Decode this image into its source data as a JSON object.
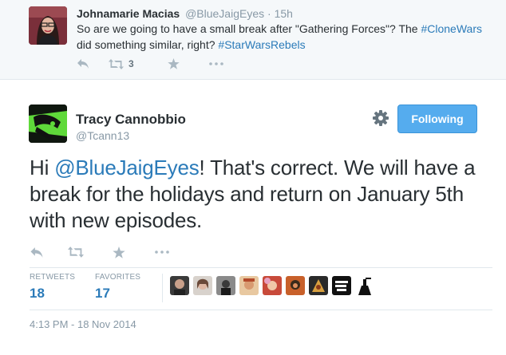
{
  "parent_tweet": {
    "author_name": "Johnamarie Macias",
    "author_handle": "@BlueJaigEyes",
    "separator": "·",
    "time": "15h",
    "text_before": "So are we going to have a small break after \"Gathering Forces\"? The ",
    "hashtag1": "#CloneWars",
    "text_middle": " did something similar, right? ",
    "hashtag2": "#StarWarsRebels",
    "retweet_count": "3"
  },
  "main_tweet": {
    "author_name": "Tracy Cannobbio",
    "author_handle": "@Tcann13",
    "follow_label": "Following",
    "text_prefix": "Hi ",
    "mention": "@BlueJaigEyes",
    "text_rest": "! That's correct. We will have a break for the holidays and return on January 5th with new episodes.",
    "stats": {
      "retweets_label": "RETWEETS",
      "retweets_value": "18",
      "favorites_label": "FAVORITES",
      "favorites_value": "17"
    },
    "timestamp": "4:13 PM - 18 Nov 2014"
  },
  "icons": {
    "reply": "reply-icon",
    "retweet": "retweet-icon",
    "favorite": "star-icon",
    "more": "more-icon",
    "settings": "gear-icon"
  },
  "colors": {
    "link": "#2b7bb9",
    "follow_button": "#55acee",
    "muted": "#8899a6",
    "action_icon": "#aab8c2",
    "parent_background": "#f5f8fa"
  }
}
